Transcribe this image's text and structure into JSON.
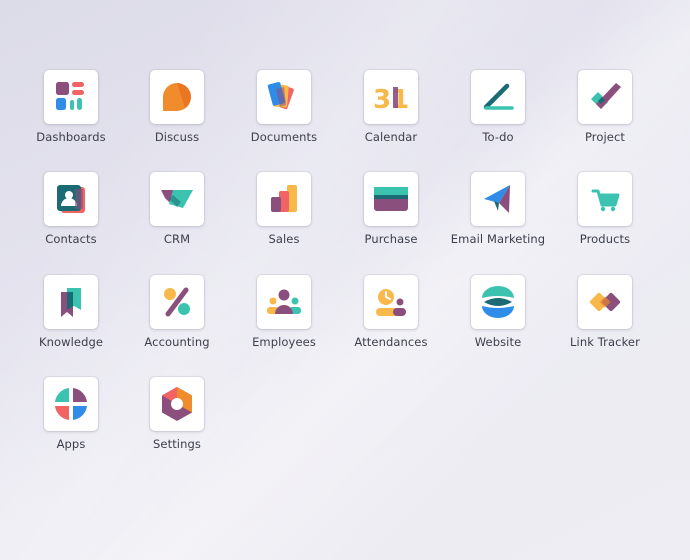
{
  "apps": [
    {
      "id": "dashboards",
      "label": "Dashboards",
      "icon": "dashboards-icon"
    },
    {
      "id": "discuss",
      "label": "Discuss",
      "icon": "discuss-icon"
    },
    {
      "id": "documents",
      "label": "Documents",
      "icon": "documents-icon"
    },
    {
      "id": "calendar",
      "label": "Calendar",
      "icon": "calendar-icon",
      "icon_text": "31"
    },
    {
      "id": "todo",
      "label": "To-do",
      "icon": "todo-icon"
    },
    {
      "id": "project",
      "label": "Project",
      "icon": "project-icon"
    },
    {
      "id": "contacts",
      "label": "Contacts",
      "icon": "contacts-icon"
    },
    {
      "id": "crm",
      "label": "CRM",
      "icon": "crm-icon"
    },
    {
      "id": "sales",
      "label": "Sales",
      "icon": "sales-icon"
    },
    {
      "id": "purchase",
      "label": "Purchase",
      "icon": "purchase-icon"
    },
    {
      "id": "email-marketing",
      "label": "Email Marketing",
      "icon": "email-marketing-icon"
    },
    {
      "id": "products",
      "label": "Products",
      "icon": "products-icon"
    },
    {
      "id": "knowledge",
      "label": "Knowledge",
      "icon": "knowledge-icon"
    },
    {
      "id": "accounting",
      "label": "Accounting",
      "icon": "accounting-icon"
    },
    {
      "id": "employees",
      "label": "Employees",
      "icon": "employees-icon"
    },
    {
      "id": "attendances",
      "label": "Attendances",
      "icon": "attendances-icon"
    },
    {
      "id": "website",
      "label": "Website",
      "icon": "website-icon"
    },
    {
      "id": "link-tracker",
      "label": "Link Tracker",
      "icon": "link-tracker-icon"
    },
    {
      "id": "apps",
      "label": "Apps",
      "icon": "apps-icon"
    },
    {
      "id": "settings",
      "label": "Settings",
      "icon": "settings-icon"
    }
  ],
  "colors": {
    "purple": "#8b4f7d",
    "teal": "#3cc3b0",
    "orange": "#f08c2c",
    "yellow": "#f8b84a",
    "red": "#f26363",
    "blue": "#2f8de8",
    "dark_teal": "#1b6b74"
  }
}
